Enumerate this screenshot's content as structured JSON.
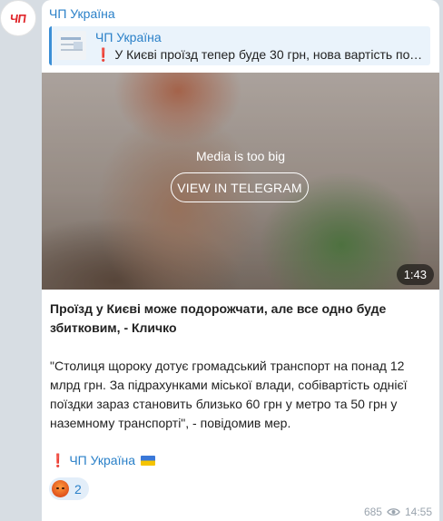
{
  "avatar": {
    "text": "ЧП"
  },
  "channel": {
    "name": "ЧП Україна"
  },
  "reply": {
    "title": "ЧП Україна",
    "text": "❗️ У Києві проїзд тепер буде 30 грн, нова вартість поч…"
  },
  "media": {
    "notice": "Media is too big",
    "button_label": "VIEW IN TELEGRAM",
    "duration": "1:43"
  },
  "post": {
    "headline": "Проїзд у Києві може подорожчати, але все одно буде збитковим, - Кличко",
    "quote": "\"Столиця щороку дотує громадський транспорт на понад 12 млрд грн. За підрахунками міської влади, собівартість однієї поїздки зараз становить близько 60 грн у метро та 50 грн у наземному транспорті\", - повідомив мер.",
    "sign_mark": "❗",
    "sign_name": "ЧП Україна"
  },
  "reaction": {
    "emoji": "angry-face-icon",
    "count": "2"
  },
  "meta": {
    "views": "685",
    "time": "14:55"
  },
  "colors": {
    "accent": "#2a80c8",
    "logo_red": "#e0262b",
    "reply_bg": "#eaf3fb"
  }
}
